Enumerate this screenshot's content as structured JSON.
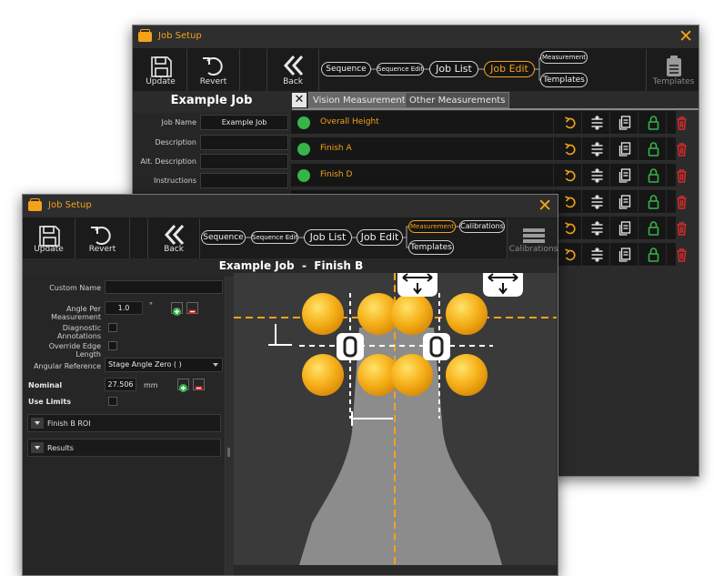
{
  "back_window": {
    "title": "Job Setup",
    "toolbar": {
      "update": "Update",
      "revert": "Revert",
      "back": "Back",
      "templates": "Templates"
    },
    "breadcrumbs": [
      "Sequence",
      "Sequence Edit",
      "Job List",
      "Job Edit",
      "Measurement",
      "Templates"
    ],
    "job_title": "Example Job",
    "fields": [
      {
        "label": "Job Name",
        "value": "Example Job"
      },
      {
        "label": "Description",
        "value": ""
      },
      {
        "label": "Alt. Description",
        "value": ""
      },
      {
        "label": "Instructions",
        "value": ""
      }
    ],
    "tabs": [
      "Vision Measurements",
      "Other Measurements"
    ],
    "measurements": [
      {
        "name": "Overall Height",
        "status": "green"
      },
      {
        "name": "Finish A",
        "status": "green"
      },
      {
        "name": "Finish D",
        "status": "green"
      }
    ]
  },
  "front_window": {
    "title": "Job Setup",
    "toolbar": {
      "update": "Update",
      "revert": "Revert",
      "back": "Back",
      "calibrations": "Calibrations"
    },
    "breadcrumbs": [
      "Sequence",
      "Sequence Edit",
      "Job List",
      "Job Edit",
      "Measurement",
      "Calibrations",
      "Templates"
    ],
    "page_title": "Example Job  -  Finish B",
    "properties": {
      "custom_name_label": "Custom Name",
      "custom_name_value": "",
      "angle_label": "Angle Per Measurement",
      "angle_value": "1.0",
      "angle_unit": "°",
      "diag_label": "Diagnostic Annotations",
      "override_label": "Override Edge Length",
      "angular_ref_label": "Angular Reference",
      "angular_ref_value": "Stage Angle Zero ( )",
      "nominal_label": "Nominal",
      "nominal_value": "27.506",
      "nominal_unit": "mm",
      "use_limits_label": "Use Limits"
    },
    "sections": [
      "Finish B ROI",
      "Results"
    ]
  },
  "colors": {
    "accent": "#f4a21a",
    "green": "#36b44a",
    "red": "#d42a2a"
  }
}
